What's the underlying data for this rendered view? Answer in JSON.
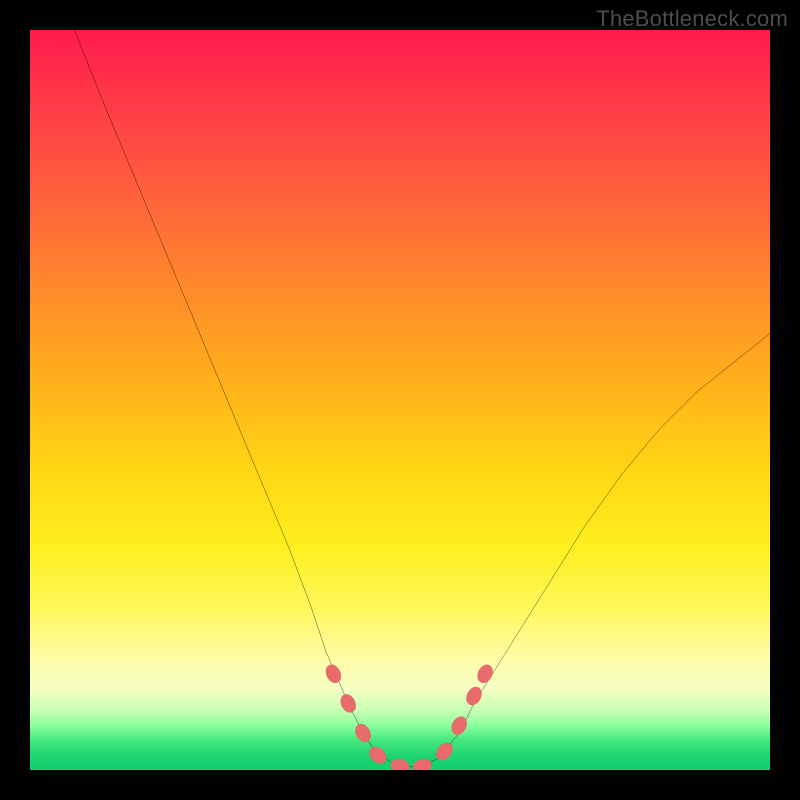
{
  "watermark": "TheBottleneck.com",
  "colors": {
    "curve_stroke": "#000000",
    "marker_fill": "#e86a6a",
    "marker_stroke": "#d25a5a",
    "gradient_top": "#ff1a4d",
    "gradient_bottom": "#12cf6d",
    "frame": "#000000"
  },
  "chart_data": {
    "type": "line",
    "title": "",
    "xlabel": "",
    "ylabel": "",
    "xlim": [
      0,
      100
    ],
    "ylim": [
      0,
      100
    ],
    "grid": false,
    "legend": false,
    "series": [
      {
        "name": "bottleneck-curve",
        "x": [
          6,
          10,
          15,
          20,
          25,
          30,
          35,
          38,
          40,
          43,
          45,
          47,
          50,
          53,
          55,
          58,
          60,
          65,
          70,
          75,
          80,
          85,
          90,
          95,
          100
        ],
        "y": [
          100,
          90,
          78,
          66,
          54,
          42,
          30,
          22,
          16,
          9,
          5,
          2,
          0.5,
          0.5,
          1.5,
          5,
          9,
          17,
          25,
          33,
          40,
          46,
          51,
          55,
          59
        ]
      }
    ],
    "markers": {
      "name": "highlighted-points",
      "shape": "rounded-pill",
      "points": [
        {
          "x": 41,
          "y": 13
        },
        {
          "x": 43,
          "y": 9
        },
        {
          "x": 45,
          "y": 5
        },
        {
          "x": 47,
          "y": 2
        },
        {
          "x": 50,
          "y": 0.5
        },
        {
          "x": 53,
          "y": 0.5
        },
        {
          "x": 56,
          "y": 2.5
        },
        {
          "x": 58,
          "y": 6
        },
        {
          "x": 60,
          "y": 10
        },
        {
          "x": 61.5,
          "y": 13
        }
      ]
    }
  }
}
